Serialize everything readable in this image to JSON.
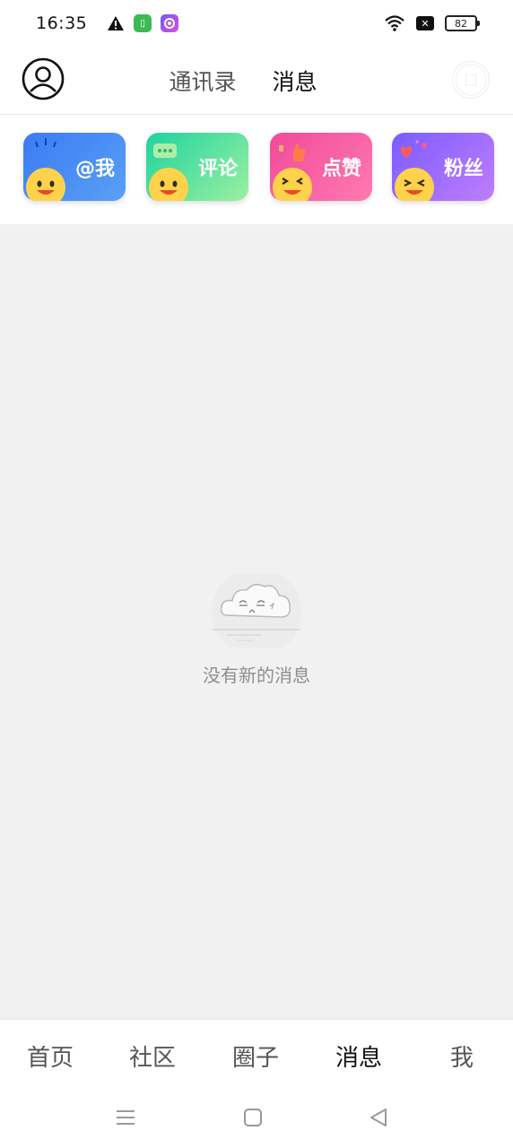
{
  "status_bar": {
    "time": "16:35",
    "battery": "82",
    "icons": [
      "warning-icon",
      "green-app-icon",
      "purple-app-icon",
      "wifi-icon",
      "no-sim-icon",
      "battery-icon"
    ]
  },
  "header": {
    "tabs": [
      {
        "label": "通讯录",
        "active": false
      },
      {
        "label": "消息",
        "active": true
      }
    ],
    "icons": [
      "avatar-icon",
      "scan-icon"
    ]
  },
  "quick_cards": [
    {
      "label": "@我",
      "color": "#3b7bf5"
    },
    {
      "label": "评论",
      "color": "#1fd3a0"
    },
    {
      "label": "点赞",
      "color": "#f04a9a"
    },
    {
      "label": "粉丝",
      "color": "#7a5cff"
    }
  ],
  "empty_state": {
    "text": "没有新的消息",
    "icon": "cloud-face-icon"
  },
  "bottom_nav": [
    {
      "label": "首页",
      "active": false
    },
    {
      "label": "社区",
      "active": false
    },
    {
      "label": "圈子",
      "active": false
    },
    {
      "label": "消息",
      "active": true
    },
    {
      "label": "我",
      "active": false
    }
  ],
  "system_nav": [
    "menu-icon",
    "home-icon",
    "back-icon"
  ]
}
